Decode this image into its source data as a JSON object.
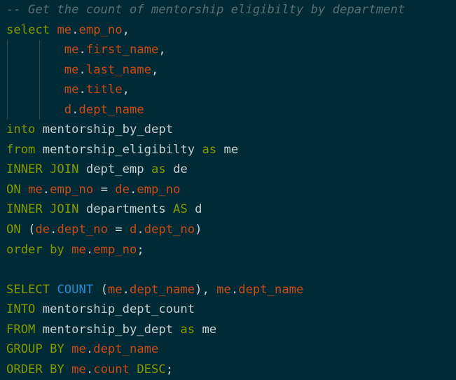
{
  "editor": {
    "theme": {
      "background": "#002b36",
      "comment": "#586e75",
      "keyword": "#859900",
      "identifier": "#cb4b16",
      "builtin": "#268bd2",
      "text": "#c5cfd0"
    },
    "lines": [
      {
        "tokens": [
          {
            "t": "comment",
            "v": "-- Get the count of mentorship eligibilty by department"
          }
        ]
      },
      {
        "tokens": [
          {
            "t": "keyword",
            "v": "select"
          },
          {
            "t": "ws",
            "v": " "
          },
          {
            "t": "ident",
            "v": "me"
          },
          {
            "t": "punct",
            "v": "."
          },
          {
            "t": "ident",
            "v": "emp_no"
          },
          {
            "t": "punct",
            "v": ","
          }
        ]
      },
      {
        "tokens": [
          {
            "t": "ws",
            "v": "        "
          },
          {
            "t": "ident",
            "v": "me"
          },
          {
            "t": "punct",
            "v": "."
          },
          {
            "t": "ident",
            "v": "first_name"
          },
          {
            "t": "punct",
            "v": ","
          }
        ]
      },
      {
        "tokens": [
          {
            "t": "ws",
            "v": "        "
          },
          {
            "t": "ident",
            "v": "me"
          },
          {
            "t": "punct",
            "v": "."
          },
          {
            "t": "ident",
            "v": "last_name"
          },
          {
            "t": "punct",
            "v": ","
          }
        ]
      },
      {
        "tokens": [
          {
            "t": "ws",
            "v": "        "
          },
          {
            "t": "ident",
            "v": "me"
          },
          {
            "t": "punct",
            "v": "."
          },
          {
            "t": "ident",
            "v": "title"
          },
          {
            "t": "punct",
            "v": ","
          }
        ]
      },
      {
        "tokens": [
          {
            "t": "ws",
            "v": "        "
          },
          {
            "t": "ident",
            "v": "d"
          },
          {
            "t": "punct",
            "v": "."
          },
          {
            "t": "ident",
            "v": "dept_name"
          }
        ]
      },
      {
        "tokens": [
          {
            "t": "keyword",
            "v": "into"
          },
          {
            "t": "ws",
            "v": " "
          },
          {
            "t": "text",
            "v": "mentorship_by_dept"
          }
        ]
      },
      {
        "tokens": [
          {
            "t": "keyword",
            "v": "from"
          },
          {
            "t": "ws",
            "v": " "
          },
          {
            "t": "text",
            "v": "mentorship_eligibilty"
          },
          {
            "t": "ws",
            "v": " "
          },
          {
            "t": "keyword",
            "v": "as"
          },
          {
            "t": "ws",
            "v": " "
          },
          {
            "t": "text",
            "v": "me"
          }
        ]
      },
      {
        "tokens": [
          {
            "t": "keyword",
            "v": "INNER JOIN"
          },
          {
            "t": "ws",
            "v": " "
          },
          {
            "t": "text",
            "v": "dept_emp"
          },
          {
            "t": "ws",
            "v": " "
          },
          {
            "t": "keyword",
            "v": "as"
          },
          {
            "t": "ws",
            "v": " "
          },
          {
            "t": "text",
            "v": "de"
          }
        ]
      },
      {
        "tokens": [
          {
            "t": "keyword",
            "v": "ON"
          },
          {
            "t": "ws",
            "v": " "
          },
          {
            "t": "ident",
            "v": "me"
          },
          {
            "t": "punct",
            "v": "."
          },
          {
            "t": "ident",
            "v": "emp_no"
          },
          {
            "t": "op",
            "v": " = "
          },
          {
            "t": "ident",
            "v": "de"
          },
          {
            "t": "punct",
            "v": "."
          },
          {
            "t": "ident",
            "v": "emp_no"
          }
        ]
      },
      {
        "tokens": [
          {
            "t": "keyword",
            "v": "INNER JOIN"
          },
          {
            "t": "ws",
            "v": " "
          },
          {
            "t": "text",
            "v": "departments"
          },
          {
            "t": "ws",
            "v": " "
          },
          {
            "t": "keyword",
            "v": "AS"
          },
          {
            "t": "ws",
            "v": " "
          },
          {
            "t": "text",
            "v": "d"
          }
        ]
      },
      {
        "tokens": [
          {
            "t": "keyword",
            "v": "ON"
          },
          {
            "t": "ws",
            "v": " "
          },
          {
            "t": "punct",
            "v": "("
          },
          {
            "t": "ident",
            "v": "de"
          },
          {
            "t": "punct",
            "v": "."
          },
          {
            "t": "ident",
            "v": "dept_no"
          },
          {
            "t": "op",
            "v": " = "
          },
          {
            "t": "ident",
            "v": "d"
          },
          {
            "t": "punct",
            "v": "."
          },
          {
            "t": "ident",
            "v": "dept_no"
          },
          {
            "t": "punct",
            "v": ")"
          }
        ]
      },
      {
        "tokens": [
          {
            "t": "keyword",
            "v": "order by"
          },
          {
            "t": "ws",
            "v": " "
          },
          {
            "t": "ident",
            "v": "me"
          },
          {
            "t": "punct",
            "v": "."
          },
          {
            "t": "ident",
            "v": "emp_no"
          },
          {
            "t": "punct",
            "v": ";"
          }
        ]
      },
      {
        "tokens": []
      },
      {
        "tokens": [
          {
            "t": "keyword",
            "v": "SELECT"
          },
          {
            "t": "ws",
            "v": " "
          },
          {
            "t": "builtin",
            "v": "COUNT"
          },
          {
            "t": "ws",
            "v": " "
          },
          {
            "t": "punct",
            "v": "("
          },
          {
            "t": "ident",
            "v": "me"
          },
          {
            "t": "punct",
            "v": "."
          },
          {
            "t": "ident",
            "v": "dept_name"
          },
          {
            "t": "punct",
            "v": "), "
          },
          {
            "t": "ident",
            "v": "me"
          },
          {
            "t": "punct",
            "v": "."
          },
          {
            "t": "ident",
            "v": "dept_name"
          }
        ]
      },
      {
        "tokens": [
          {
            "t": "keyword",
            "v": "INTO"
          },
          {
            "t": "ws",
            "v": " "
          },
          {
            "t": "text",
            "v": "mentorship_dept_count"
          }
        ]
      },
      {
        "tokens": [
          {
            "t": "keyword",
            "v": "FROM"
          },
          {
            "t": "ws",
            "v": " "
          },
          {
            "t": "text",
            "v": "mentorship_by_dept"
          },
          {
            "t": "ws",
            "v": " "
          },
          {
            "t": "keyword",
            "v": "as"
          },
          {
            "t": "ws",
            "v": " "
          },
          {
            "t": "text",
            "v": "me"
          }
        ]
      },
      {
        "tokens": [
          {
            "t": "keyword",
            "v": "GROUP BY"
          },
          {
            "t": "ws",
            "v": " "
          },
          {
            "t": "ident",
            "v": "me"
          },
          {
            "t": "punct",
            "v": "."
          },
          {
            "t": "ident",
            "v": "dept_name"
          }
        ]
      },
      {
        "tokens": [
          {
            "t": "keyword",
            "v": "ORDER BY"
          },
          {
            "t": "ws",
            "v": " "
          },
          {
            "t": "ident",
            "v": "me"
          },
          {
            "t": "punct",
            "v": "."
          },
          {
            "t": "ident",
            "v": "count"
          },
          {
            "t": "ws",
            "v": " "
          },
          {
            "t": "keyword",
            "v": "DESC"
          },
          {
            "t": "punct",
            "v": ";"
          }
        ]
      }
    ]
  }
}
